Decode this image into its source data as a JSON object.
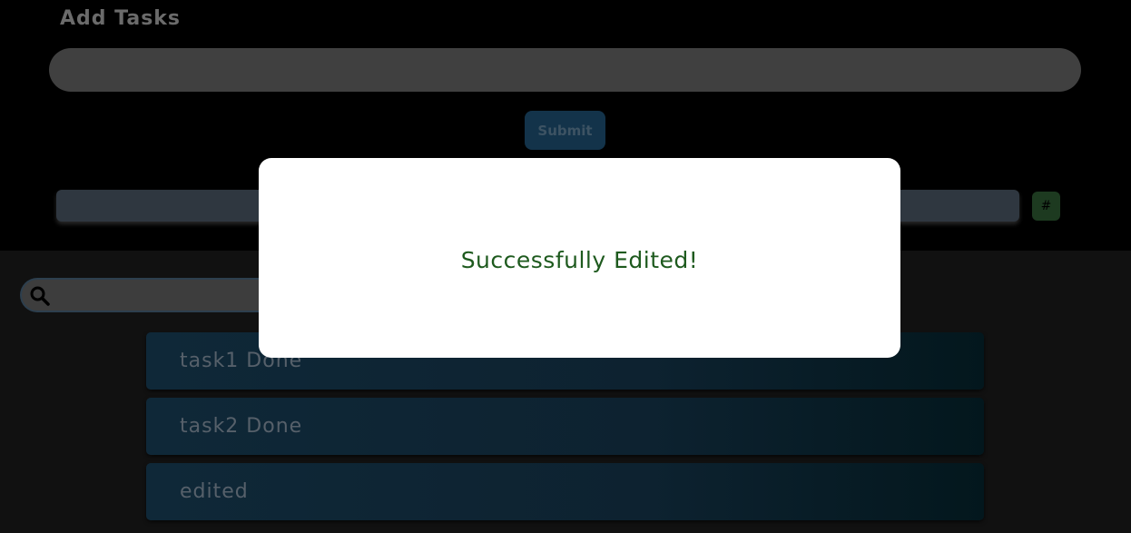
{
  "add_tasks": {
    "heading": "Add Tasks",
    "task_input_value": "",
    "submit_label": "Submit",
    "tag_input_value": "",
    "hash_button_label": "#"
  },
  "search": {
    "icon": "search-icon",
    "value": ""
  },
  "tasks": [
    {
      "text": "task1 Done"
    },
    {
      "text": "task2 Done"
    },
    {
      "text": "edited"
    }
  ],
  "modal": {
    "message": "Successfully Edited!",
    "message_color": "#1e5a1e"
  },
  "colors": {
    "page_background": "#111111",
    "top_background": "#000000",
    "submit_background": "#13334a",
    "hash_background": "#1d3a20",
    "task_background": "#0f2838"
  }
}
